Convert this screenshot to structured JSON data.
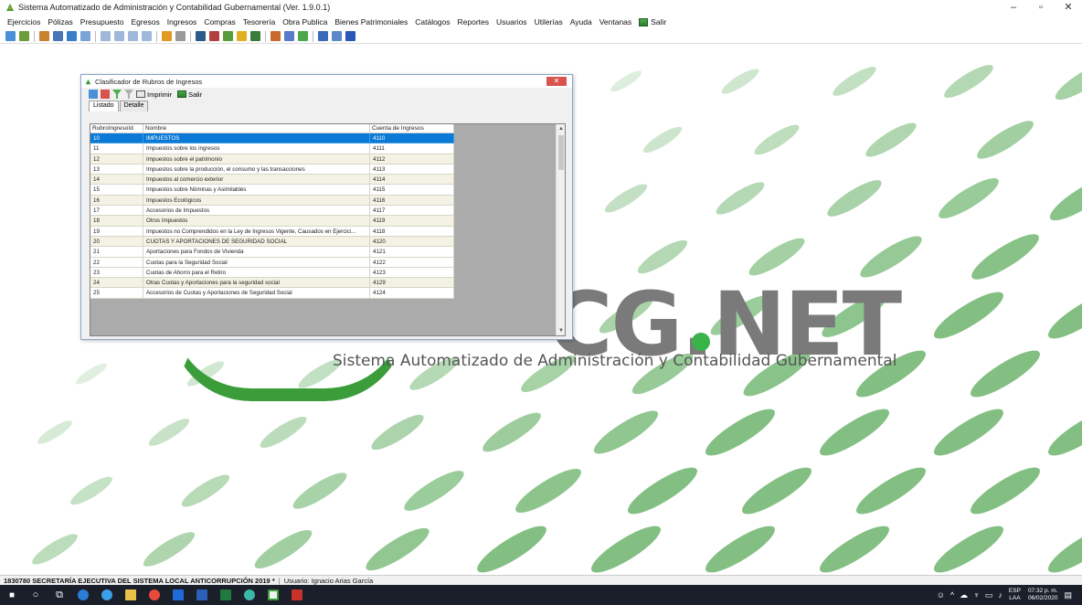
{
  "window": {
    "title": "Sistema Automatizado de Administración y Contabilidad Gubernamental  (Ver. 1.9.0.1)",
    "minimize": "–",
    "maximize": "▫",
    "close": "✕"
  },
  "menu": [
    "Ejercicios",
    "Pólizas",
    "Presupuesto",
    "Egresos",
    "Ingresos",
    "Compras",
    "Tesorería",
    "Obra Publica",
    "Bienes Patrimoniales",
    "Catálogos",
    "Reportes",
    "Usuarios",
    "Utilerías",
    "Ayuda",
    "Ventanas",
    "Salir"
  ],
  "toolbar_icons": [
    {
      "name": "refresh-icon",
      "color": "#4a8fd8"
    },
    {
      "name": "reports-icon",
      "color": "#6a9c3a"
    },
    {
      "name": "users-icon",
      "color": "#c8832e"
    },
    {
      "name": "config-icon",
      "color": "#4a76b8"
    },
    {
      "name": "table-icon",
      "color": "#3b7ec8"
    },
    {
      "name": "grid-icon",
      "color": "#7aa4d8"
    },
    {
      "name": "doc1-icon",
      "color": "#9fb8da"
    },
    {
      "name": "doc2-icon",
      "color": "#9fb8da"
    },
    {
      "name": "doc3-icon",
      "color": "#9fb8da"
    },
    {
      "name": "doc4-icon",
      "color": "#9fb8da"
    },
    {
      "name": "chart-icon",
      "color": "#e09a22"
    },
    {
      "name": "tools-icon",
      "color": "#999999"
    },
    {
      "name": "book-icon",
      "color": "#2b5b8a"
    },
    {
      "name": "pencil-icon",
      "color": "#b34040"
    },
    {
      "name": "pie-icon",
      "color": "#5a9c3a"
    },
    {
      "name": "coins-icon",
      "color": "#e0b022"
    },
    {
      "name": "ledger-icon",
      "color": "#3a7d3a"
    },
    {
      "name": "tag-icon",
      "color": "#c86a2e"
    },
    {
      "name": "people-icon",
      "color": "#5a7cc8"
    },
    {
      "name": "tree-icon",
      "color": "#4aa84a"
    },
    {
      "name": "shield-icon",
      "color": "#3a6ab8"
    },
    {
      "name": "list-icon",
      "color": "#5a88c8"
    },
    {
      "name": "help-icon",
      "color": "#2a5ab8"
    }
  ],
  "logo": {
    "text": "CG.NET",
    "subtitle": "Sistema Automatizado de Administración y Contabilidad Gubernamental"
  },
  "child": {
    "title": "Clasificador de Rubros de Ingresos",
    "close": "✕",
    "print_label": "Imprimir",
    "exit_label": "Salir",
    "tabs": [
      "Listado",
      "Detalle"
    ],
    "columns": [
      "RubroIngresoId",
      "Nombre",
      "Cuenta de Ingresos"
    ],
    "rows": [
      [
        "10",
        "IMPUESTOS",
        "4110"
      ],
      [
        "11",
        "Impuestos sobre los ingresos",
        "4111"
      ],
      [
        "12",
        "Impuestos sobre el patrimonio",
        "4112"
      ],
      [
        "13",
        "Impuestos sobre la producción, el consumo y las transacciones",
        "4113"
      ],
      [
        "14",
        "Impuestos al comercio exterior",
        "4114"
      ],
      [
        "15",
        "Impuestos sobre Nóminas y Asimilables",
        "4115"
      ],
      [
        "16",
        "Impuestos Ecológicos",
        "4116"
      ],
      [
        "17",
        "Accesorios de Impuestos",
        "4117"
      ],
      [
        "18",
        "Otros Impuestos",
        "4119"
      ],
      [
        "19",
        "Impuestos no Comprendidos en la Ley de Ingresos Vigente, Causados en Ejercici...",
        "4118"
      ],
      [
        "20",
        "CUOTAS Y APORTACIONES DE SEGURIDAD SOCIAL",
        "4120"
      ],
      [
        "21",
        "Aportaciones para Fondos de Vivienda",
        "4121"
      ],
      [
        "22",
        "Cuotas para la Seguridad Social",
        "4122"
      ],
      [
        "23",
        "Cuotas de Ahorro para el Retiro",
        "4123"
      ],
      [
        "24",
        "Otras Cuotas y Aportaciones para la seguridad social",
        "4129"
      ],
      [
        "25",
        "Accesorios de Cuotas y Aportaciones de Seguridad Social",
        "4124"
      ]
    ]
  },
  "status": {
    "org": "1830780 SECRETARÍA EJECUTIVA DEL SISTEMA LOCAL ANTICORRUPCIÓN  2019  *",
    "user": "Usuario: Ignacio Arias García"
  },
  "taskbar": {
    "lang_top": "ESP",
    "lang_bottom": "LAA",
    "time": "07:32 p. m.",
    "date": "06/02/2020"
  }
}
